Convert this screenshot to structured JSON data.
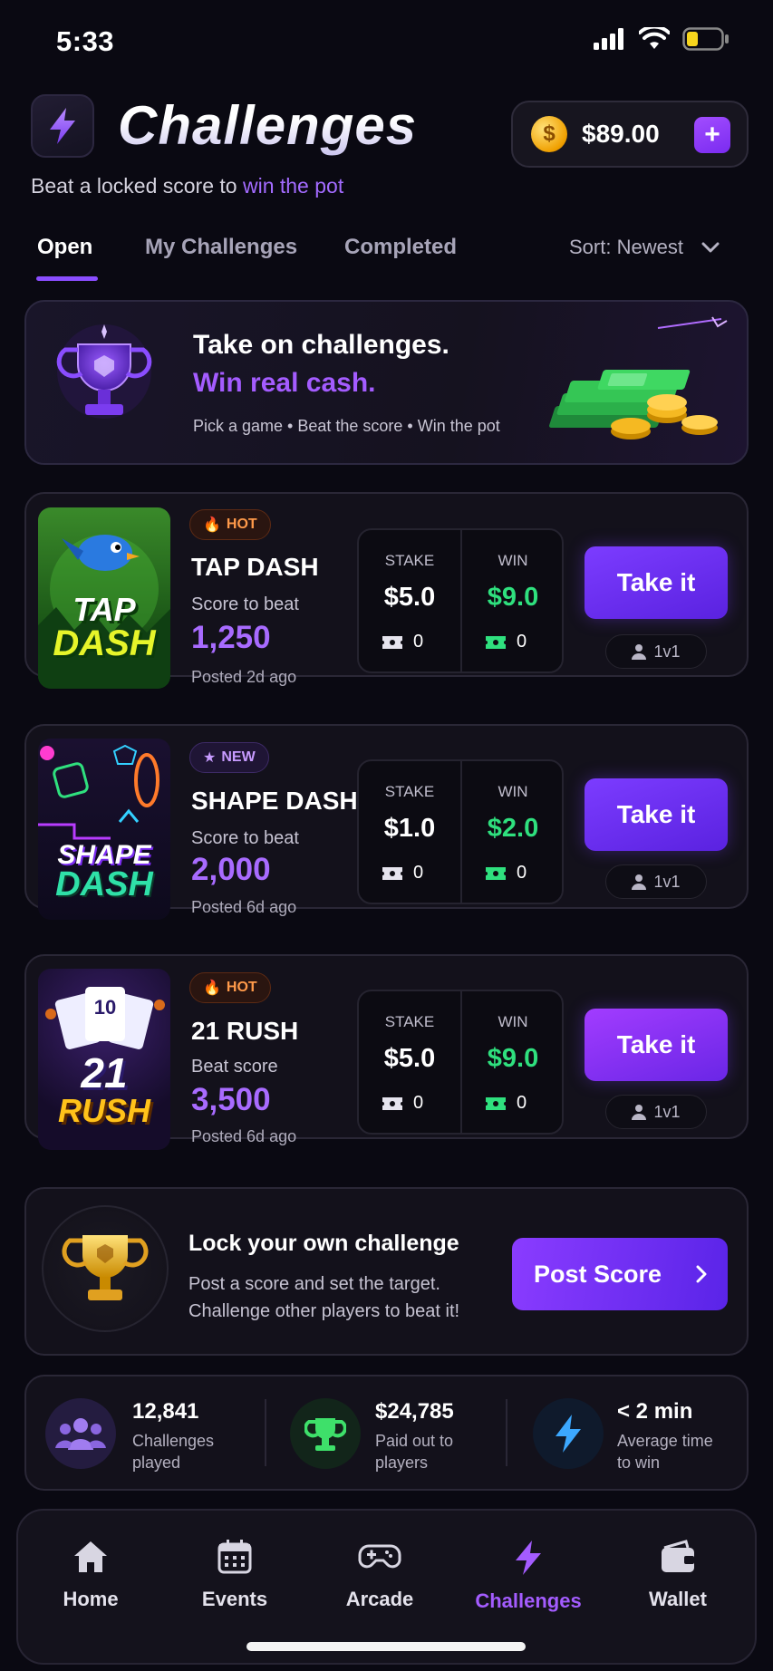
{
  "status_bar": {
    "time": "5:33"
  },
  "header": {
    "title": "Challenges",
    "subtitle_prefix": "Beat a locked score to ",
    "subtitle_accent": "win the pot",
    "balance": "$89.00",
    "coin_symbol": "$"
  },
  "tabs": [
    {
      "label": "Open",
      "active": true
    },
    {
      "label": "My Challenges",
      "active": false
    },
    {
      "label": "Completed",
      "active": false
    }
  ],
  "sort_label": "Sort: Newest",
  "banner": {
    "title_line1": "Take on challenges.",
    "title_line2": "Win real cash.",
    "subtitle": "Pick a game • Beat the score • Win the pot"
  },
  "challenges": [
    {
      "badge": "HOT",
      "badge_type": "hot",
      "thumb_text": [
        "TAP",
        "DASH"
      ],
      "name": "TAP DASH",
      "score_label": "Score to beat",
      "score": "1,250",
      "posted": "Posted 2d ago",
      "stake_label": "STAKE",
      "stake": "$5.0",
      "stake_count": "0",
      "win_label": "WIN",
      "win": "$9.0",
      "win_count": "0",
      "action": "Take it",
      "mode": "1v1"
    },
    {
      "badge": "NEW",
      "badge_type": "new",
      "thumb_text": [
        "SHAPE",
        "DASH"
      ],
      "name": "SHAPE DASH",
      "score_label": "Score to beat",
      "score": "2,000",
      "posted": "Posted 6d ago",
      "stake_label": "STAKE",
      "stake": "$1.0",
      "stake_count": "0",
      "win_label": "WIN",
      "win": "$2.0",
      "win_count": "0",
      "action": "Take it",
      "mode": "1v1"
    },
    {
      "badge": "HOT",
      "badge_type": "hot",
      "thumb_text": [
        "21",
        "RUSH"
      ],
      "thumb_card": "10",
      "name": "21 RUSH",
      "score_label": "Beat score",
      "score": "3,500",
      "posted": "Posted 6d ago",
      "stake_label": "STAKE",
      "stake": "$5.0",
      "stake_count": "0",
      "win_label": "WIN",
      "win": "$9.0",
      "win_count": "0",
      "action": "Take it",
      "mode": "1v1"
    }
  ],
  "lock_card": {
    "title": "Lock your own challenge",
    "line1": "Post a score and set the target.",
    "line2": "Challenge other players to beat it!",
    "button": "Post Score"
  },
  "stats": [
    {
      "value": "12,841",
      "label1": "Challenges",
      "label2": "played",
      "icon": "players-icon"
    },
    {
      "value": "$24,785",
      "label1": "Paid out to",
      "label2": "players",
      "icon": "trophy-icon"
    },
    {
      "value": "< 2 min",
      "label1": "Average time",
      "label2": "to win",
      "icon": "lightning-icon"
    }
  ],
  "nav": [
    {
      "label": "Home",
      "icon": "home-icon",
      "active": false
    },
    {
      "label": "Events",
      "icon": "calendar-icon",
      "active": false
    },
    {
      "label": "Arcade",
      "icon": "gamepad-icon",
      "active": false
    },
    {
      "label": "Challenges",
      "icon": "lightning-icon",
      "active": true
    },
    {
      "label": "Wallet",
      "icon": "wallet-icon",
      "active": false
    }
  ],
  "colors": {
    "accent": "#a45cff",
    "win_green": "#2fe07e",
    "hot": "#ff9a4a",
    "background": "#0a0912"
  }
}
